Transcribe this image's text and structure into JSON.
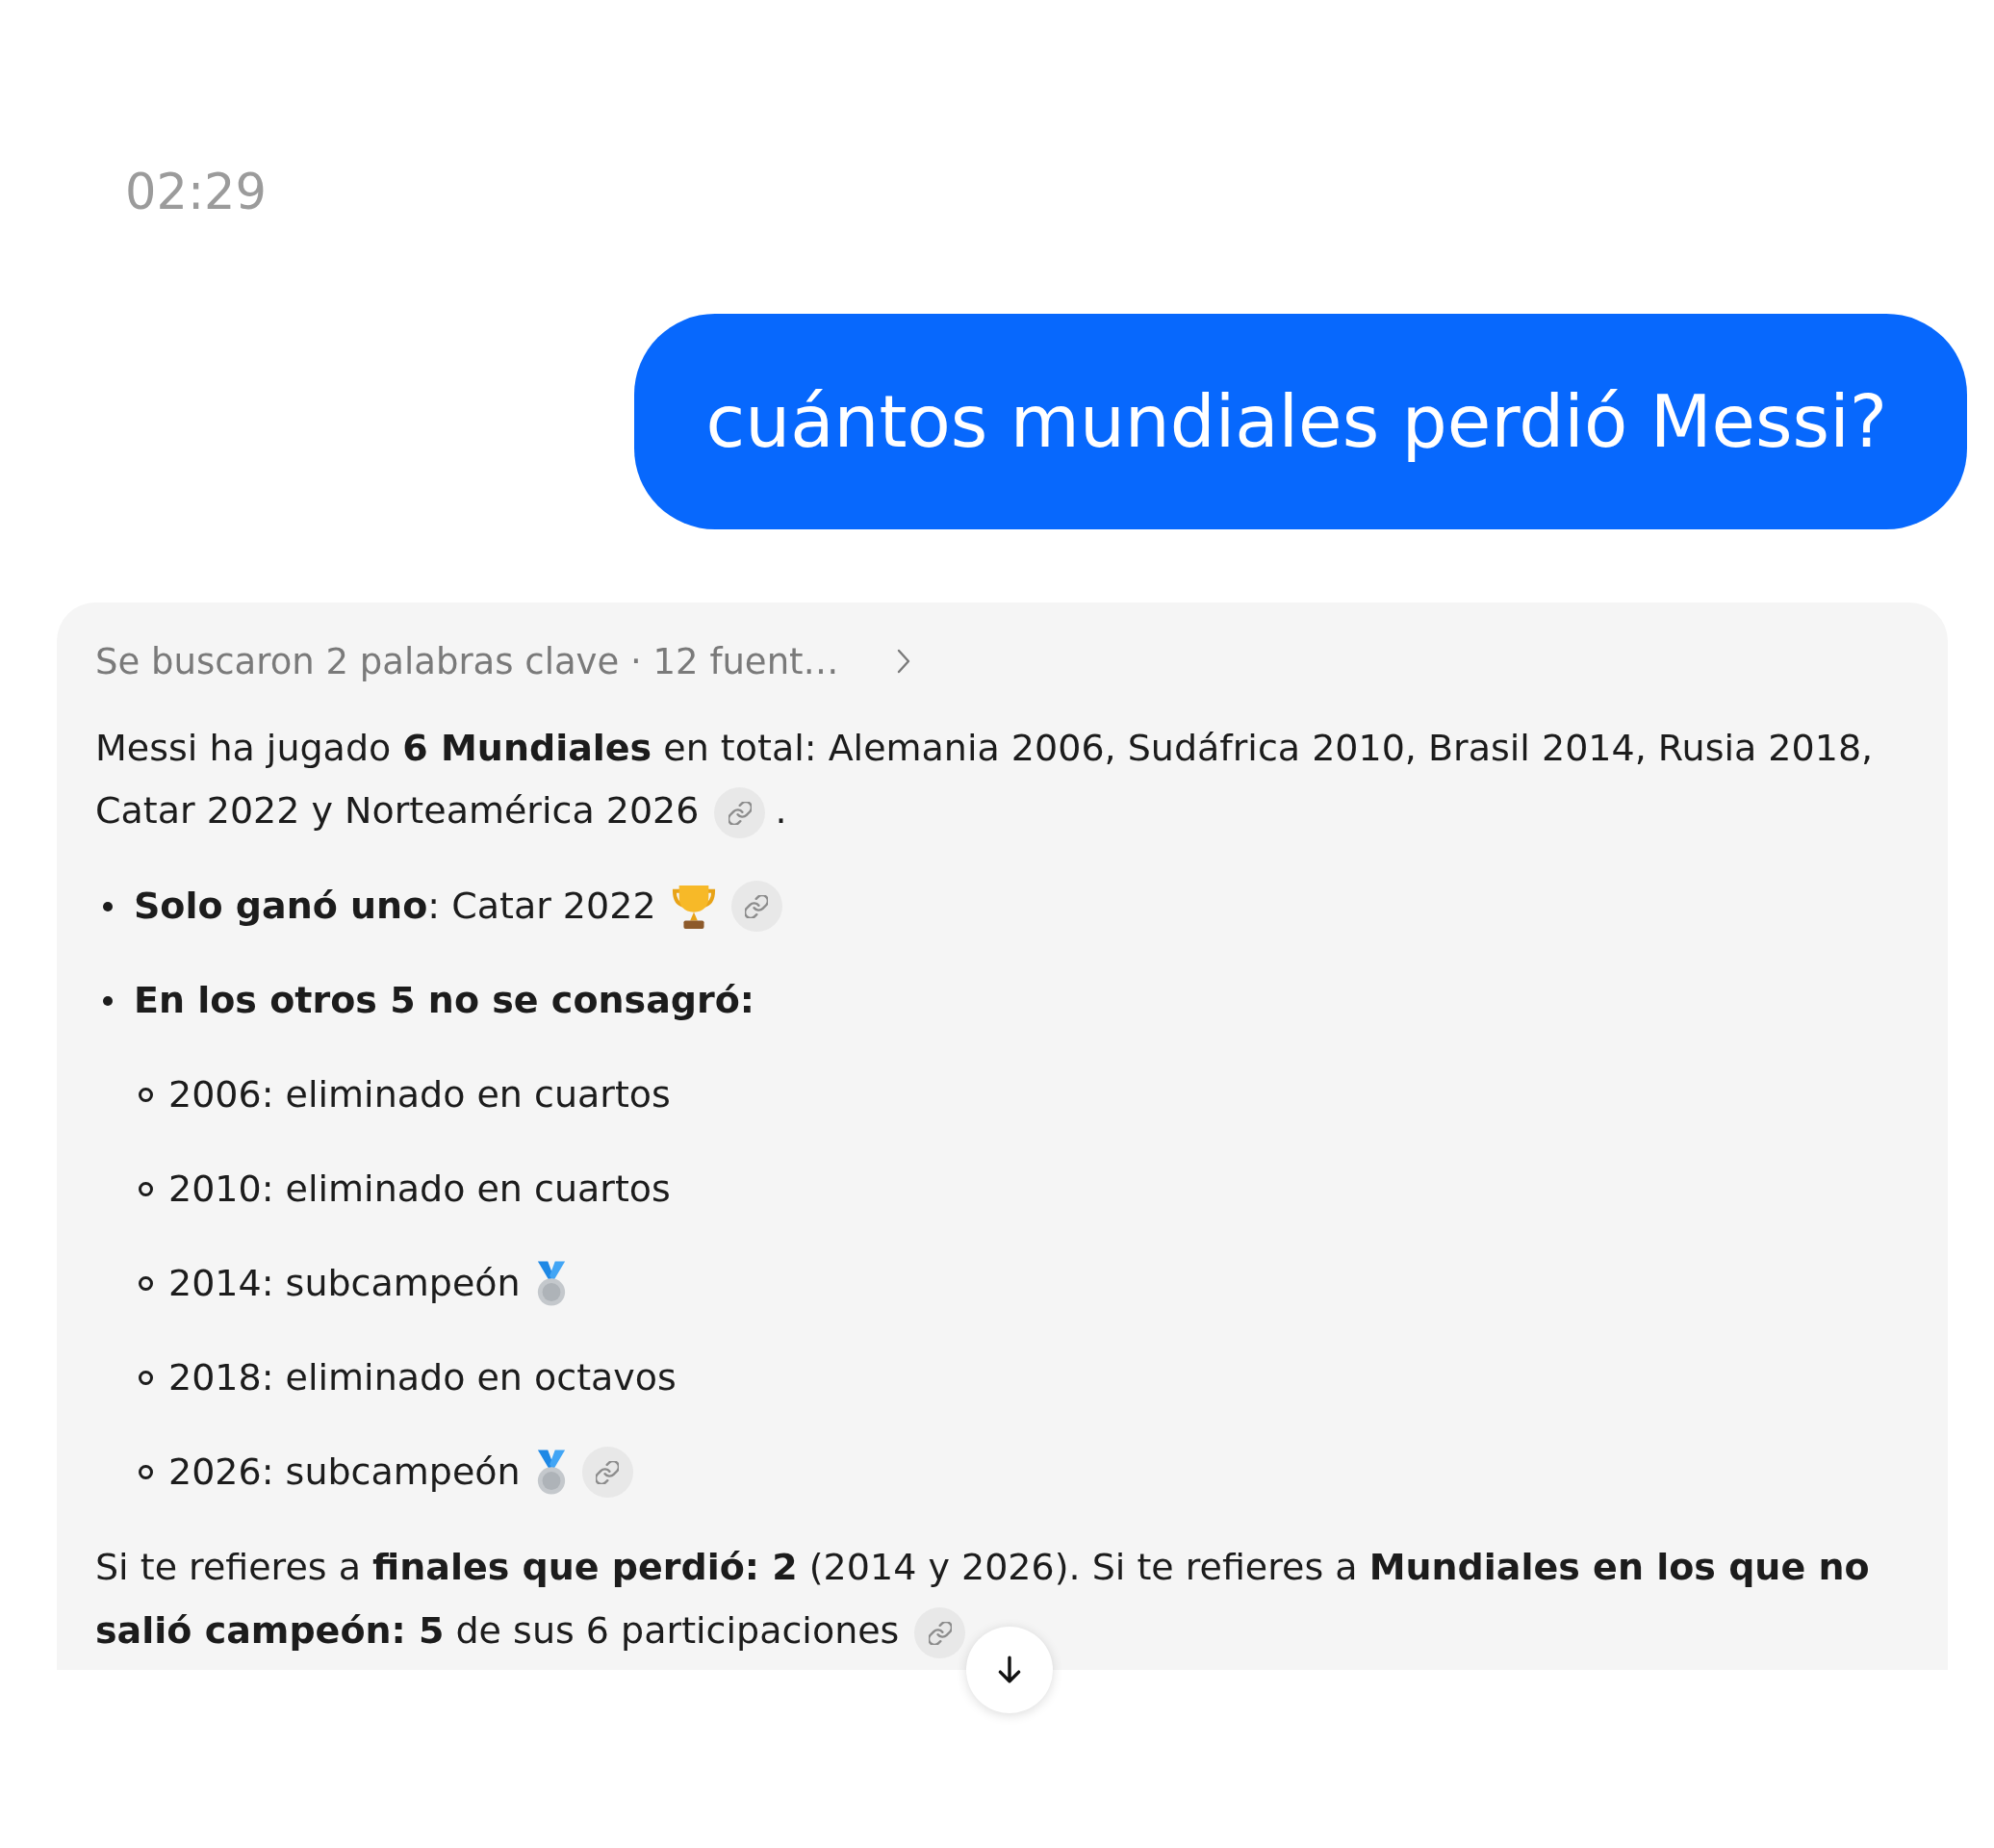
{
  "timestamp": "02:29",
  "user_message": {
    "text": "cuántos mundiales perdió Messi?"
  },
  "answer": {
    "sources_summary": "Se buscaron 2 palabras clave · 12 fuent…",
    "blocks": [
      {
        "kind": "paragraph",
        "text": "Messi ha jugado **6 Mundiales** en total: Alemania 2006, Sudáfrica 2010, Brasil 2014, Rusia 2018, Catar 2022 y Norteamérica 2026",
        "citation": true,
        "tail": "."
      },
      {
        "kind": "list",
        "items": [
          {
            "kind": "trophy",
            "text": "**Solo ganó uno**: Catar 2022",
            "citation": true
          },
          {
            "kind": "plain",
            "text": "**En los otros 5 no se consagró:**",
            "citation": false,
            "children": [
              {
                "kind": "plain",
                "text": "2006: eliminado en cuartos",
                "citation": false
              },
              {
                "kind": "plain",
                "text": "2010: eliminado en cuartos",
                "citation": false
              },
              {
                "kind": "medal",
                "text": "2014: subcampeón",
                "citation": false
              },
              {
                "kind": "plain",
                "text": "2018: eliminado en octavos",
                "citation": false
              },
              {
                "kind": "medal",
                "text": "2026: subcampeón",
                "citation": true
              }
            ]
          }
        ]
      },
      {
        "kind": "paragraph",
        "text": "Si te refieres a **finales que perdió: 2** (2014 y 2026). Si te refieres a **Mundiales en los que no salió campeón: 5** de sus 6 participaciones",
        "citation": true
      }
    ]
  }
}
